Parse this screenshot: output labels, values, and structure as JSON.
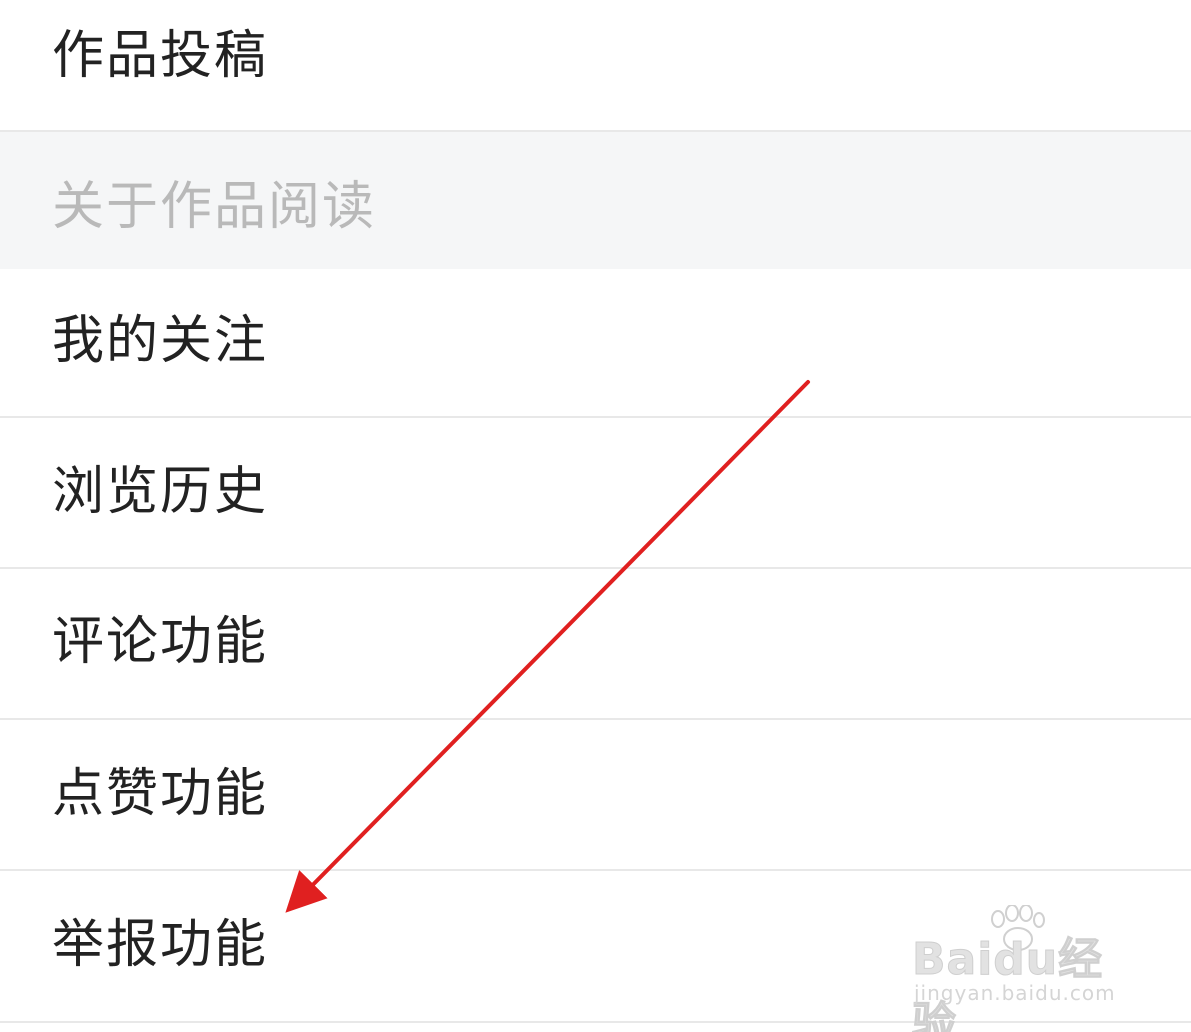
{
  "menu": {
    "top_item": "作品投稿",
    "section_title": "关于作品阅读",
    "items": [
      "我的关注",
      "浏览历史",
      "评论功能",
      "点赞功能",
      "举报功能"
    ]
  },
  "annotation": {
    "arrow_color": "#e02020"
  },
  "watermark": {
    "brand": "Baidu经验",
    "url": "jingyan.baidu.com",
    "icon": "paw-icon"
  }
}
